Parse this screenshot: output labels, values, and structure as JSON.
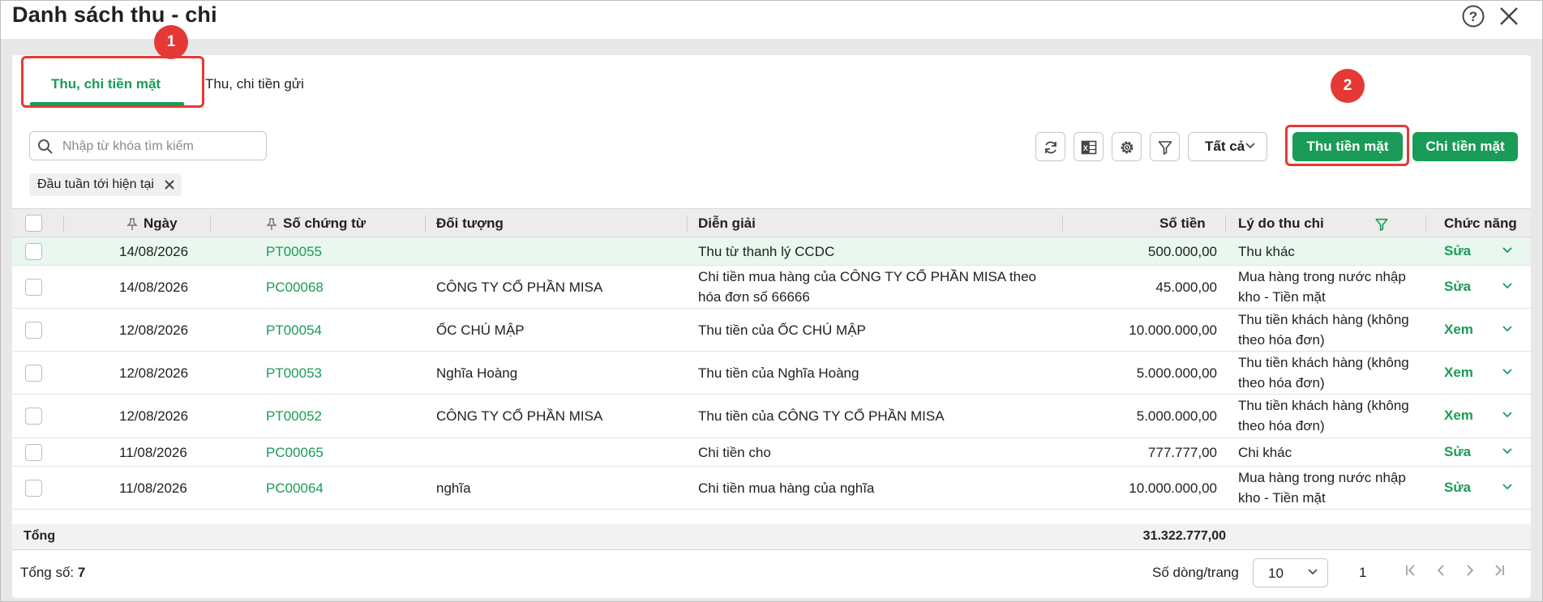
{
  "window": {
    "title": "Danh sách thu - chi"
  },
  "tabs": [
    {
      "label": "Thu, chi tiền mặt",
      "active": true
    },
    {
      "label": "Thu, chi tiền gửi",
      "active": false
    }
  ],
  "annotations": {
    "badge1": "1",
    "badge2": "2"
  },
  "toolbar": {
    "search_placeholder": "Nhập từ khóa tìm kiếm",
    "filter_select": "Tất cả",
    "receive_button": "Thu tiền mặt",
    "pay_button": "Chi tiền mặt"
  },
  "chip": {
    "label": "Đầu tuần tới hiện tại"
  },
  "table": {
    "headers": {
      "date": "Ngày",
      "voucher": "Số chứng từ",
      "object": "Đối tượng",
      "description": "Diễn giải",
      "amount": "Số tiền",
      "reason": "Lý do thu chi",
      "function": "Chức năng"
    },
    "rows": [
      {
        "date": "14/08/2026",
        "voucher": "PT00055",
        "object": "",
        "description": "Thu từ thanh lý CCDC",
        "amount": "500.000,00",
        "reason": "Thu khác",
        "action": "Sửa"
      },
      {
        "date": "14/08/2026",
        "voucher": "PC00068",
        "object": "CÔNG TY CỔ PHẦN MISA",
        "description": "Chi tiền mua hàng của CÔNG TY CỔ PHẦN MISA theo hóa đơn số 66666",
        "amount": "45.000,00",
        "reason": "Mua hàng trong nước nhập kho - Tiền mặt",
        "action": "Sửa"
      },
      {
        "date": "12/08/2026",
        "voucher": "PT00054",
        "object": "ỐC CHÚ MẬP",
        "description": "Thu tiền của ỐC CHÚ MẬP",
        "amount": "10.000.000,00",
        "reason": "Thu tiền khách hàng (không theo hóa đơn)",
        "action": "Xem"
      },
      {
        "date": "12/08/2026",
        "voucher": "PT00053",
        "object": "Nghĩa Hoàng",
        "description": "Thu tiền của Nghĩa Hoàng",
        "amount": "5.000.000,00",
        "reason": "Thu tiền khách hàng (không theo hóa đơn)",
        "action": "Xem"
      },
      {
        "date": "12/08/2026",
        "voucher": "PT00052",
        "object": "CÔNG TY CỔ PHẦN MISA",
        "description": "Thu tiền của CÔNG TY CỔ PHẦN MISA",
        "amount": "5.000.000,00",
        "reason": "Thu tiền khách hàng (không theo hóa đơn)",
        "action": "Xem"
      },
      {
        "date": "11/08/2026",
        "voucher": "PC00065",
        "object": "",
        "description": "Chi tiền cho",
        "amount": "777.777,00",
        "reason": "Chi khác",
        "action": "Sửa"
      },
      {
        "date": "11/08/2026",
        "voucher": "PC00064",
        "object": "nghĩa",
        "description": "Chi tiền mua hàng của nghĩa",
        "amount": "10.000.000,00",
        "reason": "Mua hàng trong nước nhập kho - Tiền mặt",
        "action": "Sửa"
      }
    ],
    "total_label": "Tổng",
    "total_amount": "31.322.777,00"
  },
  "footer": {
    "count_label": "Tổng số:",
    "count_value": "7",
    "rows_per_page_label": "Số dòng/trang",
    "rows_per_page_value": "10",
    "current_page": "1"
  },
  "colors": {
    "accent": "#1a9b57",
    "annotation": "#e53935"
  }
}
